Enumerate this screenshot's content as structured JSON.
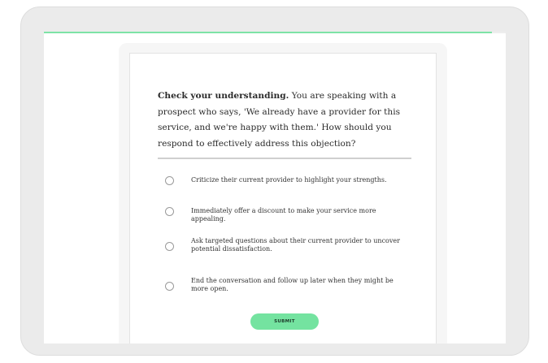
{
  "progress": {
    "fraction": 0.97,
    "color": "#7ee3a6"
  },
  "question": {
    "lead": "Check your understanding.",
    "body": " You are speaking with a prospect who says, 'We already have a provider for this service, and we're happy with them.' How should you respond to effectively address this objection?"
  },
  "options": [
    {
      "label": "Criticize their current provider to highlight your strengths.",
      "selected": false
    },
    {
      "label": "Immediately offer a discount to make your service more appealing.",
      "selected": false
    },
    {
      "label": "Ask targeted questions about their current provider to uncover potential dissatisfaction.",
      "selected": false
    },
    {
      "label": "End the conversation and follow up later when they might be more open.",
      "selected": false
    }
  ],
  "submit": {
    "label": "SUBMIT",
    "color": "#74e3a0"
  }
}
